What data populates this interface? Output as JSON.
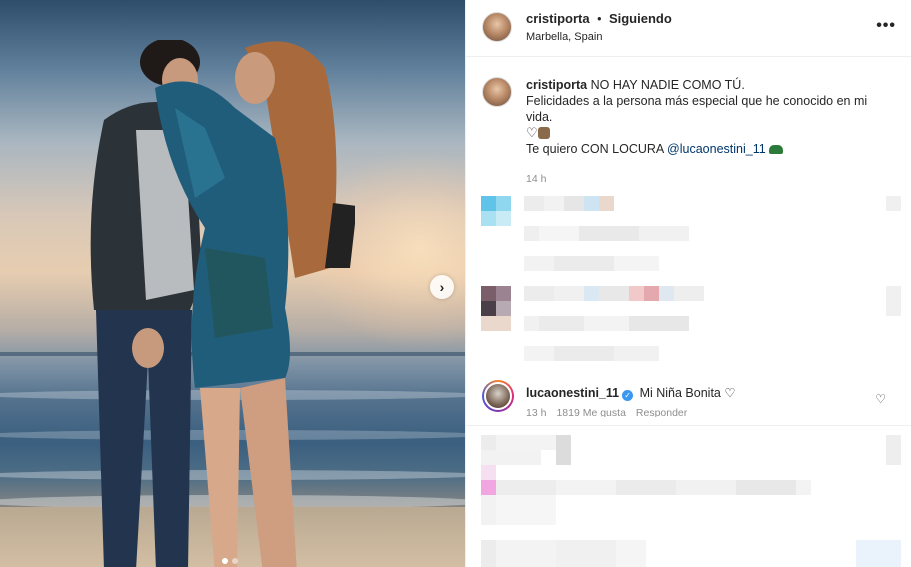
{
  "post": {
    "username": "cristiporta",
    "separator": "•",
    "follow_status": "Siguiendo",
    "location": "Marbella, Spain",
    "more_icon": "more-horizontal-icon"
  },
  "caption": {
    "username": "cristiporta",
    "line1": "NO HAY NADIE COMO TÚ.",
    "line2": "Felicidades a la persona más especial que he conocido en mi vida.",
    "line3_emojis": "♡",
    "line4_prefix": "Te quiero CON LOCURA",
    "mention": "@lucaonestini_11",
    "time": "14 h"
  },
  "comment": {
    "username": "lucaonestini_11",
    "text": "Mi Niña Bonita ♡",
    "time": "13 h",
    "likes": "1819 Me gusta",
    "reply": "Responder",
    "like_icon": "heart-icon"
  },
  "carousel": {
    "next_glyph": "›",
    "slides": 2,
    "active": 1
  },
  "colors": {
    "mention": "#00376b",
    "verified": "#3897f0",
    "meta": "#8e8e8e"
  }
}
